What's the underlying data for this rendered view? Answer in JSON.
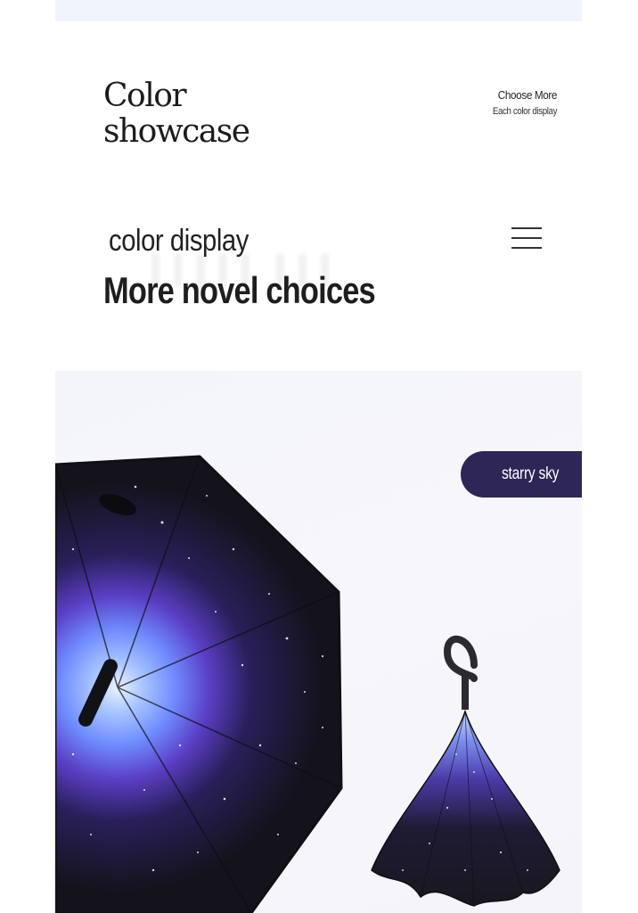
{
  "header": {
    "title_line1": "Color",
    "title_line2": "showcase",
    "choose_more": {
      "title": "Choose More",
      "subtitle": "Each color display"
    }
  },
  "section": {
    "heading": "color display",
    "subheading": "More novel choices",
    "menu_icon": "hamburger-menu-icon"
  },
  "hero": {
    "tag_label": "starry sky",
    "colors": {
      "tag_background": "#2d2656",
      "canopy_dark": "#16151f",
      "nebula_blue": "#6f8cff",
      "nebula_purple": "#6b4ad6",
      "background": "#f4f5fa"
    }
  }
}
